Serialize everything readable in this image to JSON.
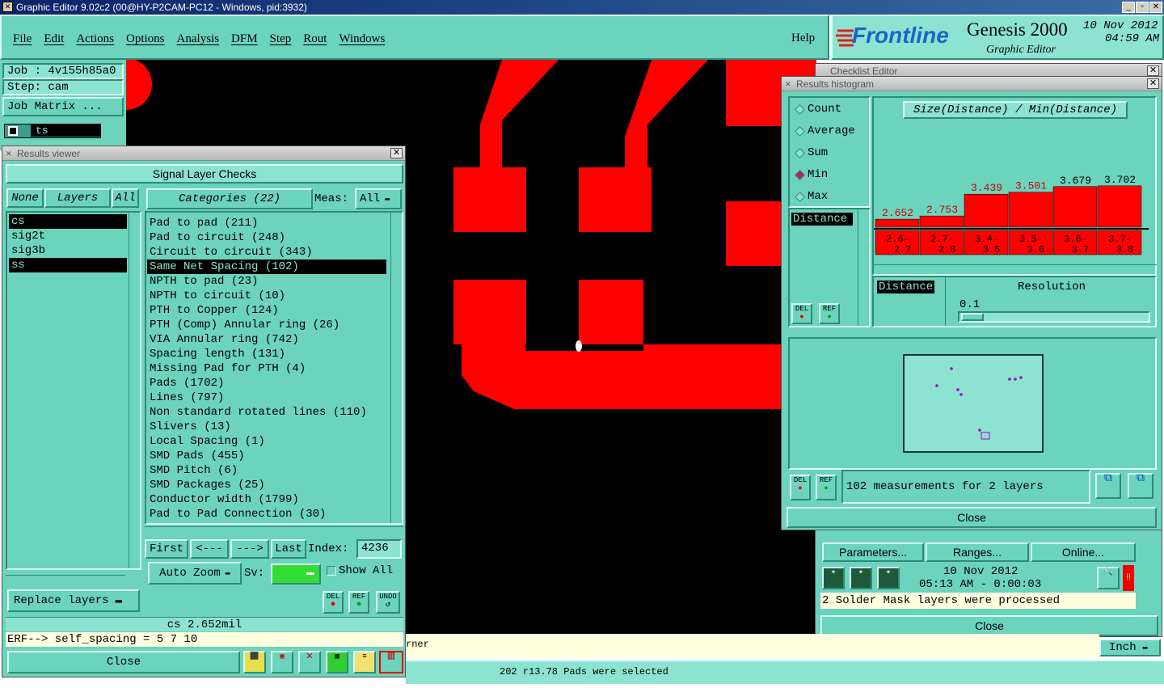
{
  "window_title": "Graphic Editor 9.02c2 (00@HY-P2CAM-PC12 - Windows, pid:3932)",
  "menu": [
    "File",
    "Edit",
    "Actions",
    "Options",
    "Analysis",
    "DFM",
    "Step",
    "Rout",
    "Windows"
  ],
  "help": "Help",
  "brand": {
    "logo": "Frontline",
    "product": "Genesis 2000",
    "subtitle": "Graphic Editor",
    "date": "10 Nov 2012",
    "time": "04:59 AM"
  },
  "left_panel": {
    "job": "Job : 4v155h85a0",
    "step": "Step: cam",
    "job_matrix": "Job Matrix ...",
    "layer_tab": "ts"
  },
  "results_viewer": {
    "title": "Results viewer",
    "header": "Signal Layer Checks",
    "none_btn": "None",
    "layers_btn": "Layers",
    "all_btn": "All",
    "layers": [
      "cs",
      "sig2t",
      "sig3b",
      "ss"
    ],
    "categories_btn": "Categories (22)",
    "meas_label": "Meas:",
    "meas_value": "All",
    "categories": [
      "Pad to pad (211)",
      "Pad to circuit (248)",
      "Circuit to circuit (343)",
      "Same Net Spacing (102)",
      "NPTH to pad (23)",
      "NPTH to circuit (10)",
      "PTH to Copper (124)",
      "PTH (Comp) Annular ring (26)",
      "VIA Annular ring (742)",
      "Spacing length (131)",
      "Missing Pad for PTH (4)",
      "Pads (1702)",
      "Lines (797)",
      "Non standard rotated lines (110)",
      "Slivers (13)",
      "Local Spacing (1)",
      "SMD Pads (455)",
      "SMD Pitch (6)",
      "SMD Packages (25)",
      "Conductor width (1799)",
      "Pad to Pad Connection (30)"
    ],
    "nav": {
      "first": "First",
      "prev": "<---",
      "next": "--->",
      "last": "Last",
      "index_label": "Index:",
      "index_value": "4236"
    },
    "auto_zoom": "Auto Zoom",
    "sv_label": "Sv:",
    "show_all": "Show All",
    "replace_layers": "Replace layers",
    "del": "DEL",
    "ref": "REF",
    "undo": "UNDO",
    "status": "cs 2.652mil",
    "erf": "ERF--> self_spacing = 5 7 10",
    "close": "Close"
  },
  "histogram": {
    "title": "Results histogram",
    "behind_title": "Checklist Editor",
    "options": [
      "Count",
      "Average",
      "Sum",
      "Min",
      "Max"
    ],
    "selected_option": "Min",
    "list_item": "Distance",
    "chart_title": "Size(Distance) / Min(Distance)",
    "resolution_label": "Resolution",
    "resolution_value": "0.1",
    "distance_label": "Distance",
    "measurements": "102 measurements for 2 layers",
    "close": "Close",
    "del": "DEL",
    "ref": "REF"
  },
  "chart_data": {
    "type": "bar",
    "title": "Size(Distance) / Min(Distance)",
    "categories": [
      "2.6-2.7",
      "2.7-2.8",
      "3.4-3.5",
      "3.5-3.6",
      "3.6-3.7",
      "3.7-3.8"
    ],
    "values": [
      2.652,
      2.753,
      3.439,
      3.501,
      3.679,
      3.702
    ],
    "value_labels": [
      "2.652",
      "2.753",
      "3.439",
      "3.501",
      "3.679",
      "3.702"
    ],
    "bin_top": [
      "2.6-",
      "2.7-",
      "3.4-",
      "3.5-",
      "3.6-",
      "3.7-"
    ],
    "bin_bottom": [
      "2.7",
      "2.8",
      "3.5",
      "3.6",
      "3.7",
      "3.8"
    ],
    "ylim": [
      0,
      3.8
    ],
    "colors": {
      "bar": "#ff0000",
      "label_high": "#000000",
      "label_low": "#cc0000"
    }
  },
  "checklist": {
    "parameters": "Parameters...",
    "ranges": "Ranges...",
    "online": "Online...",
    "date": "10 Nov 2012",
    "time": "05:13 AM - 0:00:03",
    "message": "2 Solder Mask layers were processed",
    "close": "Close"
  },
  "bottom": {
    "corner_text": "rner",
    "units": "Inch",
    "status": "202 r13.78 Pads were selected"
  },
  "colors": {
    "teal": "#6cd3bd",
    "copper": "#ff0000",
    "canvas": "#000000",
    "title_blue": "#1a66c8"
  }
}
